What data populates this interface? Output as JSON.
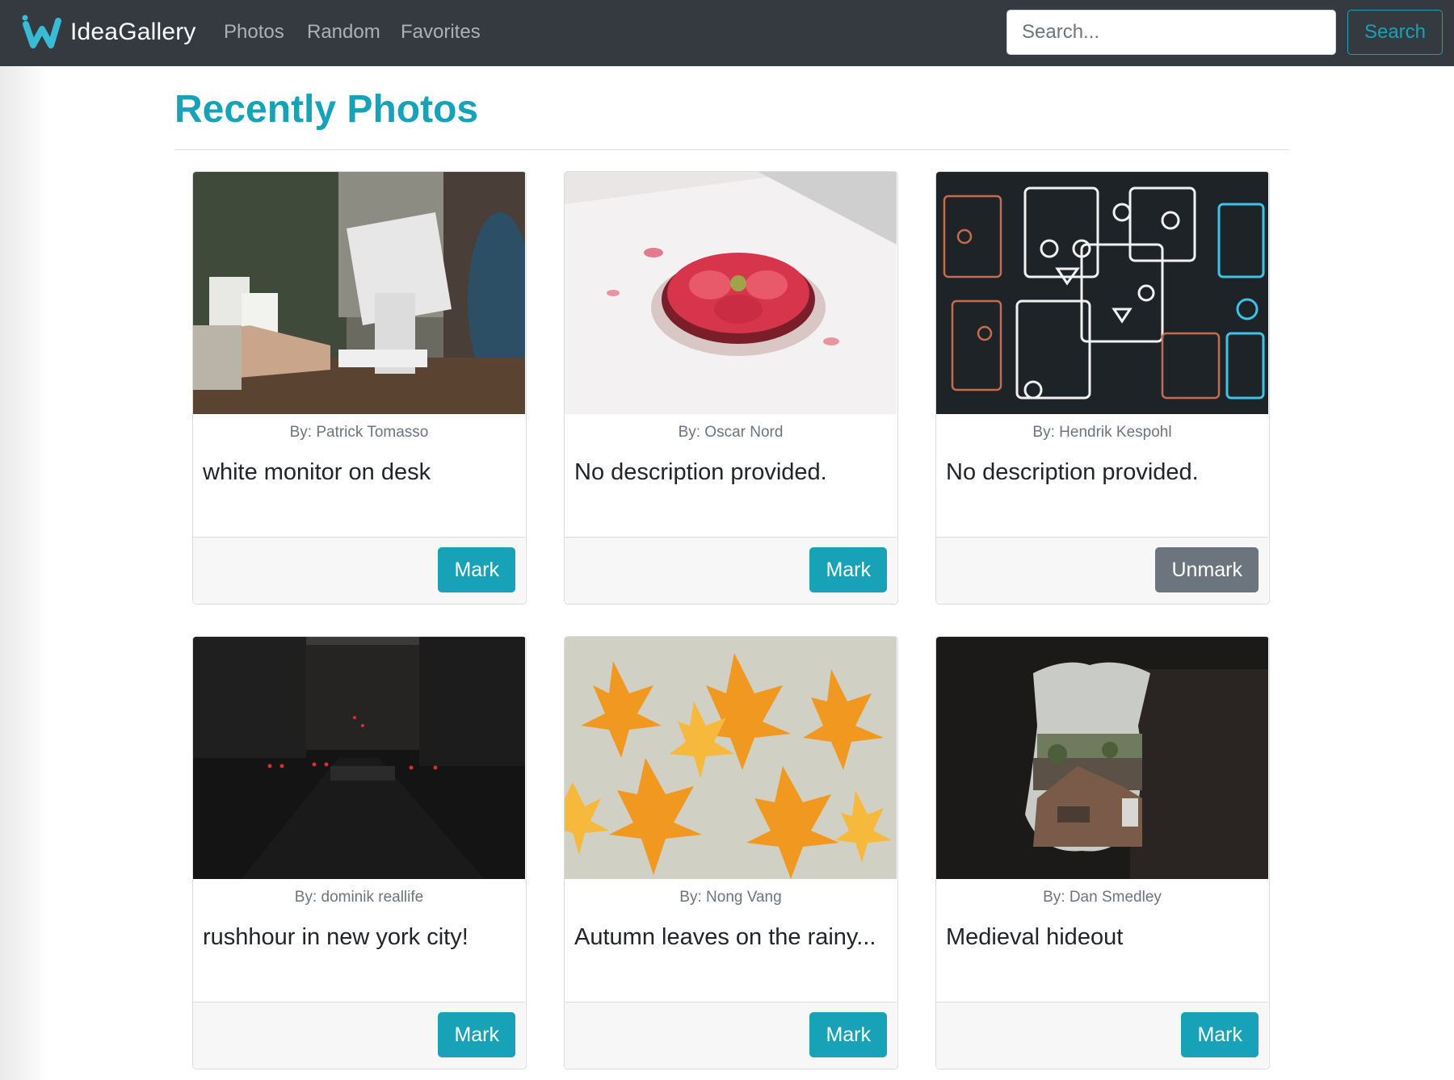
{
  "navbar": {
    "brand": "IdeaGallery",
    "logo_icon": "w-logo-icon",
    "links": [
      "Photos",
      "Random",
      "Favorites"
    ],
    "search_placeholder": "Search...",
    "search_value": "",
    "search_button": "Search"
  },
  "page": {
    "title": "Recently Photos"
  },
  "colors": {
    "accent": "#17a2b8",
    "navbar_bg": "#343a40",
    "secondary": "#6c757d"
  },
  "photos": [
    {
      "author": "By: Patrick Tomasso",
      "description": "white monitor on desk",
      "action": "Mark",
      "marked": false,
      "image": "white monitor on desk"
    },
    {
      "author": "By: Oscar Nord",
      "description": "No description provided.",
      "action": "Mark",
      "marked": false,
      "image": "strawberry tart on paper"
    },
    {
      "author": "By: Hendrik Kespohl",
      "description": "No description provided.",
      "action": "Unmark",
      "marked": true,
      "image": "abstract line doodle faces"
    },
    {
      "author": "By: dominik reallife",
      "description": "rushhour in new york city!",
      "action": "Mark",
      "marked": false,
      "image": "dark street with car lights"
    },
    {
      "author": "By: Nong Vang",
      "description": "Autumn leaves on the rainy...",
      "action": "Mark",
      "marked": false,
      "image": "orange autumn leaves"
    },
    {
      "author": "By: Dan Smedley",
      "description": "Medieval hideout",
      "action": "Mark",
      "marked": false,
      "image": "view through stone window"
    }
  ]
}
